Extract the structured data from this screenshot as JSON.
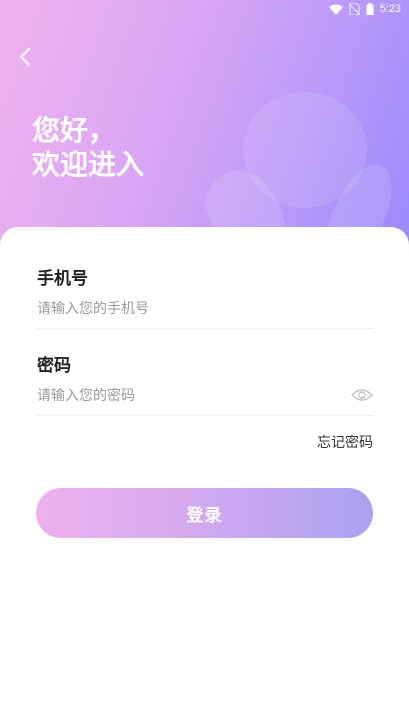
{
  "status_bar": {
    "time": "5:23",
    "icons": [
      "wifi-icon",
      "no-sim-icon",
      "battery-icon"
    ]
  },
  "header": {
    "back_icon": "chevron-left-icon",
    "greeting_line1": "您好，",
    "greeting_line2": "欢迎进入"
  },
  "form": {
    "phone_label": "手机号",
    "phone_placeholder": "请输入您的手机号",
    "phone_value": "",
    "password_label": "密码",
    "password_placeholder": "请输入您的密码",
    "password_value": "",
    "password_toggle_icon": "eye-icon",
    "forgot_label": "忘记密码",
    "login_label": "登录"
  },
  "colors": {
    "gradient_start": "#f1b2ef",
    "gradient_end": "#9a88fb",
    "button_start": "#eeb1ee",
    "button_end": "#aaa2ef"
  }
}
